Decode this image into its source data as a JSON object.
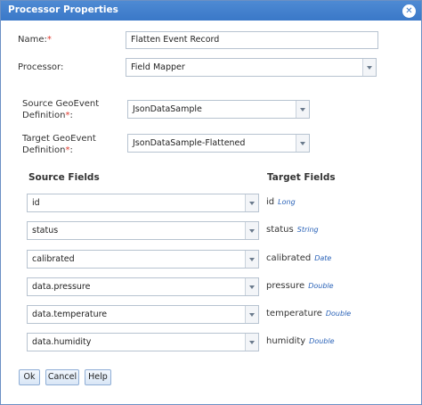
{
  "dialog": {
    "title": "Processor Properties",
    "close_glyph": "✕"
  },
  "form": {
    "name_label": "Name:",
    "required_mark": "*",
    "name_value": "Flatten Event Record",
    "processor_label": "Processor:",
    "processor_value": "Field Mapper",
    "source_def_label_1": "Source GeoEvent",
    "source_def_label_2": "Definition",
    "source_def_label_3": ":",
    "source_def_value": "JsonDataSample",
    "target_def_label_1": "Target GeoEvent",
    "target_def_label_2": "Definition",
    "target_def_label_3": ":",
    "target_def_value": "JsonDataSample-Flattened"
  },
  "mapping": {
    "source_header": "Source Fields",
    "target_header": "Target Fields",
    "rows": [
      {
        "source": "id",
        "target": "id",
        "type": "Long"
      },
      {
        "source": "status",
        "target": "status",
        "type": "String"
      },
      {
        "source": "calibrated",
        "target": "calibrated",
        "type": "Date"
      },
      {
        "source": "data.pressure",
        "target": "pressure",
        "type": "Double"
      },
      {
        "source": "data.temperature",
        "target": "temperature",
        "type": "Double"
      },
      {
        "source": "data.humidity",
        "target": "humidity",
        "type": "Double"
      }
    ]
  },
  "buttons": {
    "ok": "Ok",
    "cancel": "Cancel",
    "help": "Help"
  },
  "colors": {
    "titlebar": "#3a78c8",
    "required": "#e03a2f",
    "type_text": "#2b63b8"
  }
}
